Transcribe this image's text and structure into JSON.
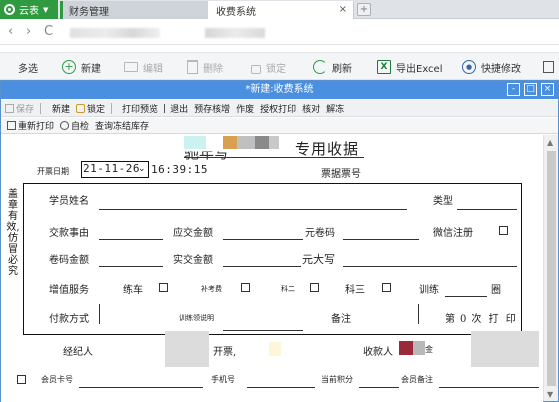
{
  "browser": {
    "app_button": "云表",
    "tabs": [
      {
        "label": "财务管理"
      },
      {
        "label": "收费系统"
      }
    ],
    "tab_close": "×",
    "new_tab": "+"
  },
  "nav": {
    "back": "‹",
    "forward": "›",
    "reload": "C"
  },
  "main_toolbar": {
    "items": [
      {
        "label": "多选",
        "icon": "none"
      },
      {
        "label": "新建",
        "icon": "plus-circle-icon"
      },
      {
        "label": "编辑",
        "icon": "folder-icon"
      },
      {
        "label": "删除",
        "icon": "trash-icon"
      },
      {
        "label": "锁定",
        "icon": "lock-icon"
      },
      {
        "label": "刷新",
        "icon": "refresh-icon"
      },
      {
        "label": "导出Excel",
        "icon": "excel-icon"
      },
      {
        "label": "快捷修改",
        "icon": "hexagon-icon"
      }
    ]
  },
  "dialog": {
    "title": "*新建:收费系统",
    "controls": {
      "minimize": "-",
      "maximize": "□",
      "close": "×"
    },
    "toolbar1": [
      {
        "label": "保存"
      },
      {
        "label": "新建"
      },
      {
        "label": "锁定"
      },
      {
        "label": "打印预览"
      },
      {
        "label": "退出"
      },
      {
        "label": "预存核增"
      },
      {
        "label": "作废"
      },
      {
        "label": "授权打印"
      },
      {
        "label": "核对"
      },
      {
        "label": "解冻"
      }
    ],
    "toolbar2": [
      {
        "label": "重新打印"
      },
      {
        "label": "自检"
      },
      {
        "label": "查询冻结库存"
      }
    ]
  },
  "receipt": {
    "title_visible": "专用收据",
    "title_partial": "驰年写",
    "issue_date_label": "开票日期",
    "issue_date": "21-11-26",
    "issue_time": "16:39:15",
    "receipt_no_label": "票据票号",
    "side_note": "盖章有效,仿冒必究",
    "student_name_label": "学员姓名",
    "type_label": "类型",
    "pay_reason_label": "交款事由",
    "due_amount_label": "应交金额",
    "voucher_label": "元卷码",
    "wechat_label": "微信注册",
    "voucher_amount_label": "卷码金额",
    "paid_amount_label": "实交金额",
    "yuan_upper_label": "元大写",
    "value_added_label": "增值服务",
    "practice_car_label": "练车",
    "supplement_fee_label": "补考费",
    "subject2_label": "科二",
    "subject3_label": "科三",
    "training_label": "训练",
    "laps_label": "圈",
    "payment_method_label": "付款方式",
    "training_collect_label": "训练领说明",
    "remark_label": "备注",
    "print_count_label": "第",
    "print_count_value": "0",
    "print_count_suffix": "次 打 印",
    "handler_label": "经纪人",
    "issuer_label": "开票,",
    "payee_label": "收款人",
    "payee_suffix": "金",
    "member_card_label": "会员卡号",
    "phone_label": "手机号",
    "points_label": "当前积分",
    "member_note_label": "会员备注"
  },
  "colors": {
    "app_green": "#2f9a3f",
    "dialog_blue": "#4a8fe0",
    "accent_green": "#2e9c4a",
    "blurred_orange": "#d9a050",
    "blurred_gray": "#8a8a8a",
    "blurred_red": "#9a2a3a",
    "blurred_teal": "#a8e8e8"
  }
}
